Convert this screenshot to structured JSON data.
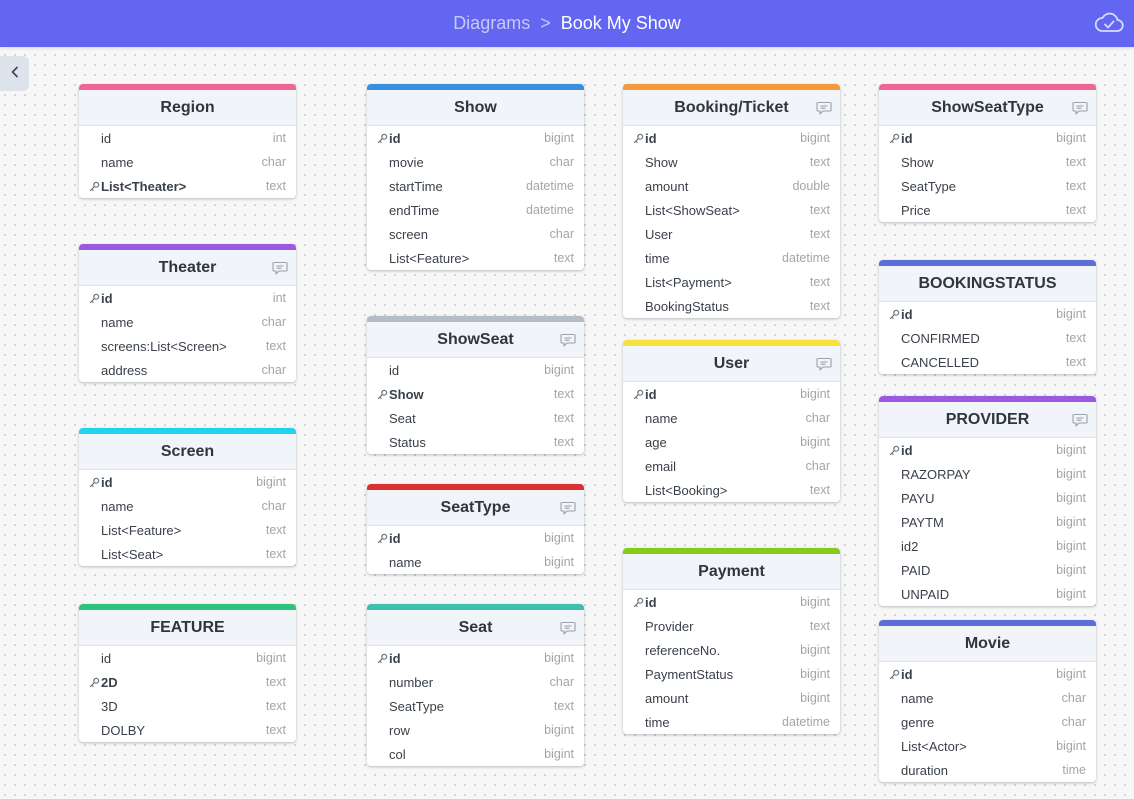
{
  "header": {
    "breadcrumb_root": "Diagrams",
    "breadcrumb_sep": ">",
    "breadcrumb_current": "Book My Show",
    "accent": "#6366f1"
  },
  "tables": {
    "region": {
      "name": "Region",
      "color": "#f06595",
      "fields": [
        {
          "name": "id",
          "type": "int",
          "key": false
        },
        {
          "name": "name",
          "type": "char",
          "key": false
        },
        {
          "name": "List<Theater>",
          "type": "text",
          "key": true
        }
      ]
    },
    "theater": {
      "name": "Theater",
      "color": "#9b59e0",
      "fields": [
        {
          "name": "id",
          "type": "int",
          "key": true
        },
        {
          "name": "name",
          "type": "char",
          "key": false
        },
        {
          "name": "screens:List<Screen>",
          "type": "text",
          "key": false
        },
        {
          "name": "address",
          "type": "char",
          "key": false
        }
      ]
    },
    "screen": {
      "name": "Screen",
      "color": "#22d3ee",
      "fields": [
        {
          "name": "id",
          "type": "bigint",
          "key": true
        },
        {
          "name": "name",
          "type": "char",
          "key": false
        },
        {
          "name": "List<Feature>",
          "type": "text",
          "key": false
        },
        {
          "name": "List<Seat>",
          "type": "text",
          "key": false
        }
      ]
    },
    "feature": {
      "name": "FEATURE",
      "color": "#2ec27e",
      "fields": [
        {
          "name": "id",
          "type": "bigint",
          "key": false
        },
        {
          "name": "2D",
          "type": "text",
          "key": true
        },
        {
          "name": "3D",
          "type": "text",
          "key": false
        },
        {
          "name": "DOLBY",
          "type": "text",
          "key": false
        }
      ]
    },
    "show": {
      "name": "Show",
      "color": "#3b8fe0",
      "fields": [
        {
          "name": "id",
          "type": "bigint",
          "key": true
        },
        {
          "name": "movie",
          "type": "char",
          "key": false
        },
        {
          "name": "startTime",
          "type": "datetime",
          "key": false
        },
        {
          "name": "endTime",
          "type": "datetime",
          "key": false
        },
        {
          "name": "screen",
          "type": "char",
          "key": false
        },
        {
          "name": "List<Feature>",
          "type": "text",
          "key": false
        }
      ]
    },
    "showseat": {
      "name": "ShowSeat",
      "color": "#b4bcc6",
      "fields": [
        {
          "name": "id",
          "type": "bigint",
          "key": false
        },
        {
          "name": "Show",
          "type": "text",
          "key": true
        },
        {
          "name": "Seat",
          "type": "text",
          "key": false
        },
        {
          "name": "Status",
          "type": "text",
          "key": false
        }
      ]
    },
    "seattype": {
      "name": "SeatType",
      "color": "#dc2f2f",
      "fields": [
        {
          "name": "id",
          "type": "bigint",
          "key": true
        },
        {
          "name": "name",
          "type": "bigint",
          "key": false
        }
      ]
    },
    "seat": {
      "name": "Seat",
      "color": "#3fbfad",
      "fields": [
        {
          "name": "id",
          "type": "bigint",
          "key": true
        },
        {
          "name": "number",
          "type": "char",
          "key": false
        },
        {
          "name": "SeatType",
          "type": "text",
          "key": false
        },
        {
          "name": "row",
          "type": "bigint",
          "key": false
        },
        {
          "name": "col",
          "type": "bigint",
          "key": false
        }
      ]
    },
    "booking": {
      "name": "Booking/Ticket",
      "color": "#f59a3c",
      "fields": [
        {
          "name": "id",
          "type": "bigint",
          "key": true
        },
        {
          "name": "Show",
          "type": "text",
          "key": false
        },
        {
          "name": "amount",
          "type": "double",
          "key": false
        },
        {
          "name": "List<ShowSeat>",
          "type": "text",
          "key": false
        },
        {
          "name": "User",
          "type": "text",
          "key": false
        },
        {
          "name": "time",
          "type": "datetime",
          "key": false
        },
        {
          "name": "List<Payment>",
          "type": "text",
          "key": false
        },
        {
          "name": "BookingStatus",
          "type": "text",
          "key": false
        }
      ]
    },
    "user": {
      "name": "User",
      "color": "#f5e23c",
      "fields": [
        {
          "name": "id",
          "type": "bigint",
          "key": true
        },
        {
          "name": "name",
          "type": "char",
          "key": false
        },
        {
          "name": "age",
          "type": "bigint",
          "key": false
        },
        {
          "name": "email",
          "type": "char",
          "key": false
        },
        {
          "name": "List<Booking>",
          "type": "text",
          "key": false
        }
      ]
    },
    "payment": {
      "name": "Payment",
      "color": "#84cc16",
      "fields": [
        {
          "name": "id",
          "type": "bigint",
          "key": true
        },
        {
          "name": "Provider",
          "type": "text",
          "key": false
        },
        {
          "name": "referenceNo.",
          "type": "bigint",
          "key": false
        },
        {
          "name": "PaymentStatus",
          "type": "bigint",
          "key": false
        },
        {
          "name": "amount",
          "type": "bigint",
          "key": false
        },
        {
          "name": "time",
          "type": "datetime",
          "key": false
        }
      ]
    },
    "showseattype": {
      "name": "ShowSeatType",
      "color": "#f06595",
      "fields": [
        {
          "name": "id",
          "type": "bigint",
          "key": true
        },
        {
          "name": "Show",
          "type": "text",
          "key": false
        },
        {
          "name": "SeatType",
          "type": "text",
          "key": false
        },
        {
          "name": "Price",
          "type": "text",
          "key": false
        }
      ]
    },
    "bookingstatus": {
      "name": "BOOKINGSTATUS",
      "color": "#5b6fd6",
      "fields": [
        {
          "name": "id",
          "type": "bigint",
          "key": true
        },
        {
          "name": "CONFIRMED",
          "type": "text",
          "key": false
        },
        {
          "name": "CANCELLED",
          "type": "text",
          "key": false
        }
      ]
    },
    "provider": {
      "name": "PROVIDER",
      "color": "#9b59e0",
      "fields": [
        {
          "name": "id",
          "type": "bigint",
          "key": true
        },
        {
          "name": "RAZORPAY",
          "type": "bigint",
          "key": false
        },
        {
          "name": "PAYU",
          "type": "bigint",
          "key": false
        },
        {
          "name": "PAYTM",
          "type": "bigint",
          "key": false
        },
        {
          "name": "id2",
          "type": "bigint",
          "key": false
        },
        {
          "name": "PAID",
          "type": "bigint",
          "key": false
        },
        {
          "name": "UNPAID",
          "type": "bigint",
          "key": false
        }
      ]
    },
    "movie": {
      "name": "Movie",
      "color": "#5b6fd6",
      "fields": [
        {
          "name": "id",
          "type": "bigint",
          "key": true
        },
        {
          "name": "name",
          "type": "char",
          "key": false
        },
        {
          "name": "genre",
          "type": "char",
          "key": false
        },
        {
          "name": "List<Actor>",
          "type": "bigint",
          "key": false
        },
        {
          "name": "duration",
          "type": "time",
          "key": false
        }
      ]
    }
  }
}
